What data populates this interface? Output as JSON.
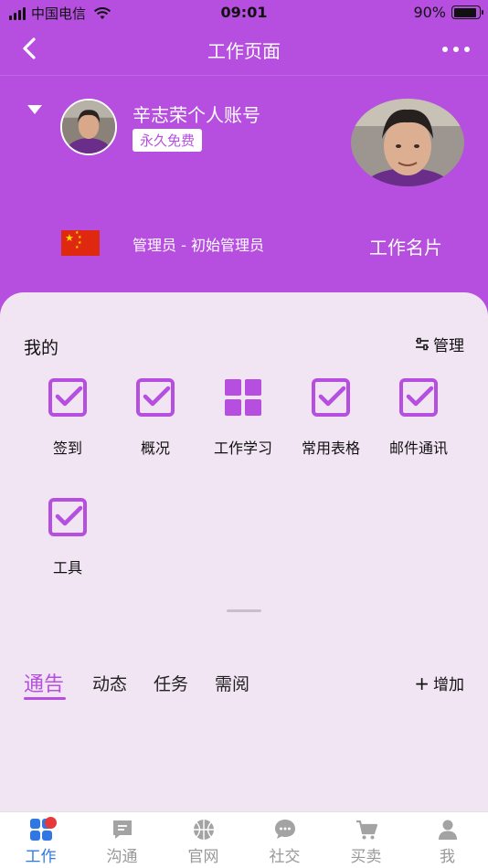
{
  "status_bar": {
    "carrier": "中国电信",
    "time": "09:01",
    "battery_text": "90%",
    "battery_level": 0.9
  },
  "nav": {
    "title": "工作页面",
    "back_icon": "chevron-left-icon",
    "more_icon": "more-dots-icon"
  },
  "profile": {
    "account_name": "辛志荣个人账号",
    "plan_badge": "永久免费",
    "role": "管理员 - 初始管理员",
    "business_card_label": "工作名片"
  },
  "my_section": {
    "title": "我的",
    "manage_label": "管理",
    "tools": [
      {
        "label": "签到",
        "icon": "checkbox-icon"
      },
      {
        "label": "概况",
        "icon": "checkbox-icon"
      },
      {
        "label": "工作学习",
        "icon": "grid-icon"
      },
      {
        "label": "常用表格",
        "icon": "checkbox-icon"
      },
      {
        "label": "邮件通讯",
        "icon": "checkbox-icon"
      },
      {
        "label": "工具",
        "icon": "checkbox-icon"
      }
    ]
  },
  "feed_tabs": {
    "tabs": [
      "通告",
      "动态",
      "任务",
      "需阅"
    ],
    "active_index": 0,
    "add_label": "增加"
  },
  "tabbar": {
    "items": [
      {
        "label": "工作",
        "icon": "apps-icon"
      },
      {
        "label": "沟通",
        "icon": "message-icon"
      },
      {
        "label": "官网",
        "icon": "basketball-icon"
      },
      {
        "label": "社交",
        "icon": "chat-bubble-icon"
      },
      {
        "label": "买卖",
        "icon": "cart-icon"
      },
      {
        "label": "我",
        "icon": "person-icon"
      }
    ],
    "active_index": 0
  },
  "colors": {
    "accent": "#b64ee0",
    "tab_active": "#2f78e4",
    "badge_red": "#e63939"
  }
}
